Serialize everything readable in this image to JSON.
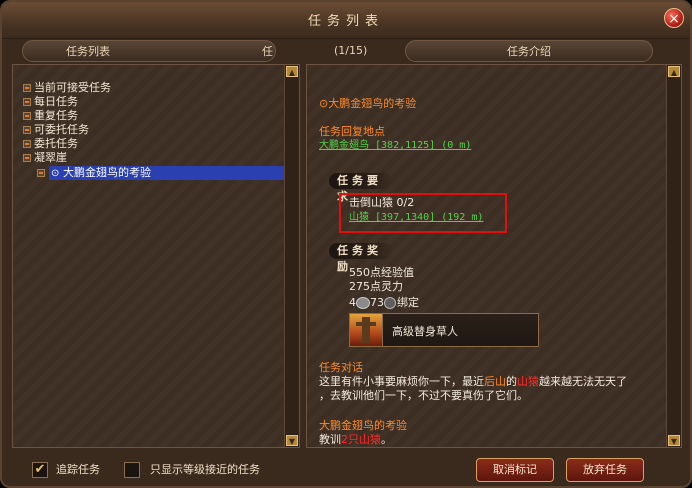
{
  "window": {
    "title": "任务列表"
  },
  "tabs": {
    "left_title": "任务列表",
    "tracking": "任务追踪",
    "count": "(1/15)",
    "right_title": "任务介绍"
  },
  "tree": {
    "items": [
      {
        "label": "当前可接受任务"
      },
      {
        "label": "每日任务"
      },
      {
        "label": "重复任务"
      },
      {
        "label": "可委托任务"
      },
      {
        "label": "委托任务"
      },
      {
        "label": "凝翠崖"
      }
    ],
    "selected": "大鹏金翅鸟的考验"
  },
  "detail": {
    "quest_title": "大鹏金翅鸟的考验",
    "return_label": "任务回复地点",
    "return_link": "大鹏金翅鸟 [382,1125] (0 m)",
    "requirement_header": "任务要求",
    "requirement_text": "击倒山猿 0/2",
    "requirement_link": "山猿 [397,1340] (192 m)",
    "reward_header": "任务奖励",
    "reward_exp": "550点经验值",
    "reward_spirit": "275点灵力",
    "reward_money_a": "4",
    "reward_money_b": "73",
    "reward_bind": "绑定",
    "reward_item_name": "高级替身草人",
    "dialog_label": "任务对话",
    "dialog_line1_a": "这里有件小事要麻烦你一下，最近",
    "dialog_line1_b": "后山",
    "dialog_line1_c": "的",
    "dialog_line1_d": "山猿",
    "dialog_line1_e": "越来越无法无天了",
    "dialog_line2": "，去教训他们一下，不过不要真伤了它们。",
    "objective_title": "大鹏金翅鸟的考验",
    "objective_a": "教训",
    "objective_b": "2只山猿",
    "objective_c": "。"
  },
  "bottom": {
    "track_label": "追踪任务",
    "track_checked": true,
    "filter_label": "只显示等级接近的任务",
    "filter_checked": false,
    "cancel_mark": "取消标记",
    "abandon": "放弃任务"
  },
  "colors": {
    "accent_orange": "#ff8a2a",
    "link_green": "#53d34a",
    "highlight_red": "#ff2b2b",
    "selected_blue": "#2a3fb0"
  }
}
